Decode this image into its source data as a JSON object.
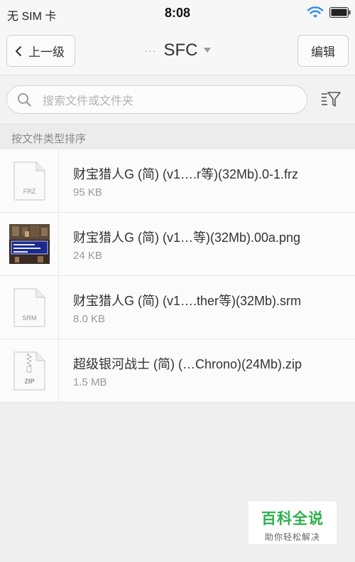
{
  "status_bar": {
    "carrier": "无 SIM 卡",
    "time": "8:08",
    "wifi_icon": "wifi-icon",
    "battery_icon": "battery-icon"
  },
  "nav": {
    "back_label": "上一级",
    "breadcrumb_dots": "···",
    "title": "SFC",
    "edit_label": "编辑"
  },
  "search": {
    "placeholder": "搜索文件或文件夹"
  },
  "sort": {
    "label": "按文件类型排序"
  },
  "files": [
    {
      "name": "财宝猎人G (简) (v1….r等)(32Mb).0-1.frz",
      "size": "95 KB",
      "type_label": "FRZ"
    },
    {
      "name": "财宝猎人G (简) (v1…等)(32Mb).00a.png",
      "size": "24 KB",
      "type_label": ""
    },
    {
      "name": "财宝猎人G (简) (v1….ther等)(32Mb).srm",
      "size": "8.0 KB",
      "type_label": "SRM"
    },
    {
      "name": "超级银河战士 (简) (…Chrono)(24Mb).zip",
      "size": "1.5 MB",
      "type_label": "ZIP"
    }
  ],
  "watermark": {
    "title": "百科全说",
    "subtitle": "助你轻松解决"
  },
  "colors": {
    "accent_blue": "#2d8cf0",
    "watermark_green": "#2bb14b"
  }
}
